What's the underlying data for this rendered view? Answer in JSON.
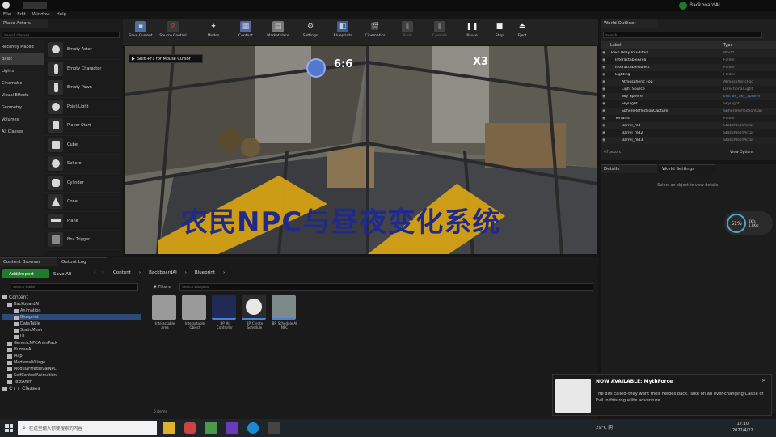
{
  "window": {
    "title": "BackboardAI"
  },
  "menu": [
    "File",
    "Edit",
    "Window",
    "Help"
  ],
  "place_actors": {
    "tab": "Place Actors",
    "search_placeholder": "Search Classes",
    "categories": [
      "Recently Placed",
      "Basic",
      "Lights",
      "Cinematic",
      "Visual Effects",
      "Geometry",
      "Volumes",
      "All Classes"
    ],
    "selected_category": "Basic",
    "items": [
      "Empty Actor",
      "Empty Character",
      "Empty Pawn",
      "Point Light",
      "Player Start",
      "Cube",
      "Sphere",
      "Cylinder",
      "Cone",
      "Plane",
      "Box Trigger"
    ]
  },
  "toolbar": {
    "buttons": [
      {
        "label": "Save Current",
        "icon": "save-icon"
      },
      {
        "label": "Source Control",
        "icon": "source-control-icon"
      },
      {
        "label": "Modes",
        "icon": "modes-icon"
      },
      {
        "label": "Content",
        "icon": "content-icon"
      },
      {
        "label": "Marketplace",
        "icon": "marketplace-icon"
      },
      {
        "label": "Settings",
        "icon": "settings-icon"
      },
      {
        "label": "Blueprints",
        "icon": "blueprints-icon"
      },
      {
        "label": "Cinematics",
        "icon": "cinematics-icon"
      },
      {
        "label": "Build",
        "icon": "build-icon"
      },
      {
        "label": "Compile",
        "icon": "compile-icon"
      },
      {
        "label": "Pause",
        "icon": "pause-icon"
      },
      {
        "label": "Stop",
        "icon": "stop-icon"
      },
      {
        "label": "Eject",
        "icon": "eject-icon"
      }
    ]
  },
  "viewport": {
    "hint": "Shift+F1 for Mouse Cursor",
    "clock": "6:6",
    "speed": "X3",
    "overlay_title": "农民NPC与昼夜变化系统"
  },
  "outliner": {
    "tab": "World Outliner",
    "search_placeholder": "Search...",
    "col_label": "Label",
    "col_type": "Type",
    "rows": [
      {
        "label": "Town (Play In Editor)",
        "type": "World"
      },
      {
        "label": "InteractableArea",
        "type": "Folder"
      },
      {
        "label": "InteractableObject",
        "type": "Folder"
      },
      {
        "label": "Lighting",
        "type": "Folder"
      },
      {
        "label": "Atmospheric Fog",
        "type": "AtmosphericFog"
      },
      {
        "label": "Light Source",
        "type": "DirectionalLight"
      },
      {
        "label": "Sky Sphere",
        "type": "Edit BP_Sky_Sphere"
      },
      {
        "label": "SkyLight",
        "type": "SkyLight"
      },
      {
        "label": "SphereReflectionCapture",
        "type": "SphereReflectionCap"
      },
      {
        "label": "Terrains",
        "type": "Folder"
      },
      {
        "label": "Barrel_md",
        "type": "StaticMeshActor"
      },
      {
        "label": "Barrel_md2",
        "type": "StaticMeshActor"
      },
      {
        "label": "Barrel_md3",
        "type": "StaticMeshActor"
      }
    ],
    "count": "97 actors",
    "view_options": "View Options"
  },
  "details": {
    "tab1": "Details",
    "tab2": "World Settings",
    "empty": "Select an object to view details."
  },
  "perf": {
    "percent": "51%",
    "up": "1K/s",
    "down": "1.8K/s"
  },
  "content_browser": {
    "tab1": "Content Browser",
    "tab2": "Output Log",
    "add_import": "Add/Import",
    "save_all": "Save All",
    "breadcrumb": [
      "Content",
      "BackboardAI",
      "Blueprint"
    ],
    "search_paths": "Search Paths",
    "filters": "Filters",
    "search_blueprint": "Search Blueprint",
    "tree": [
      "Content",
      "BackboardAI",
      "Animation",
      "Blueprint",
      "DataTable",
      "StaticMesh",
      "UI",
      "GenericNPCAnimPack",
      "HumanAI",
      "Map",
      "MedievalVillage",
      "ModularMedievalNPC",
      "SelfControlAnimation",
      "TextAnim",
      "C++ Classes"
    ],
    "assets": [
      "Interactable Area",
      "Interactable Object",
      "BP_AI Controller",
      "BP_Create Schedule",
      "BP_Schedule AI NPC"
    ],
    "item_count": "5 items"
  },
  "notification": {
    "title": "NOW AVAILABLE: MythForce",
    "body": "The 80s called–they want their heroes back. Take on an ever-changing Castle of Evil in this roguelite adventure."
  },
  "taskbar": {
    "search": "在这里输入你要搜索的内容",
    "weather": "29°C 阴",
    "time": "17:10",
    "date": "2022/4/22"
  }
}
